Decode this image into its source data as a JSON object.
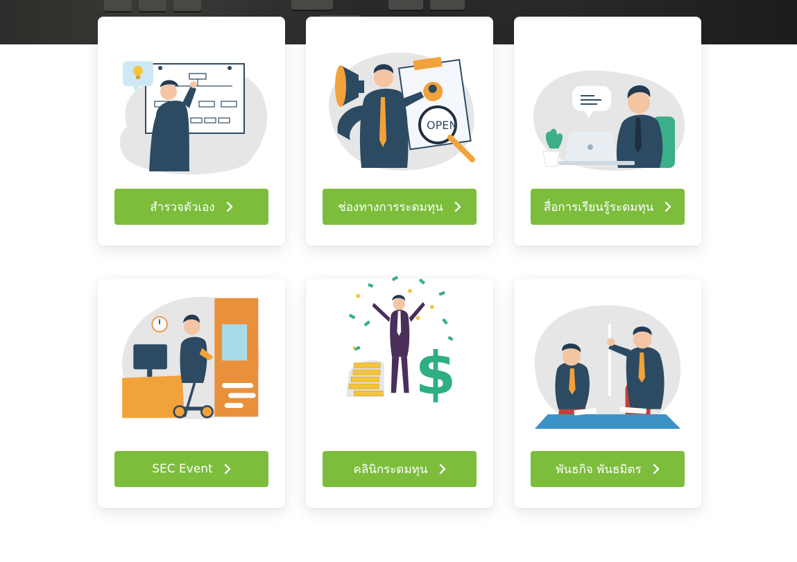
{
  "cards": [
    {
      "id": "self-assessment",
      "label": "สำรวจตัวเอง",
      "icon": "strategy-board-icon"
    },
    {
      "id": "investment-channels",
      "label": "ช่องทางการระดมทุน",
      "icon": "job-search-megaphone-icon"
    },
    {
      "id": "learning-media",
      "label": "สื่อการเรียนรู้ระดมทุน",
      "icon": "laptop-chat-icon"
    },
    {
      "id": "sec-event",
      "label": "SEC Event",
      "icon": "office-scooter-icon"
    },
    {
      "id": "clinic",
      "label": "คลินิกระดมทุน",
      "icon": "money-celebration-icon"
    },
    {
      "id": "partners",
      "label": "พันธกิจ พันธมิตร",
      "icon": "business-meeting-icon"
    }
  ],
  "colors": {
    "button": "#7cbd3c",
    "suit": "#2d4a63",
    "tie": "#f2a23a",
    "accent_teal": "#3aaf8a",
    "blob": "#e6e6e6"
  }
}
